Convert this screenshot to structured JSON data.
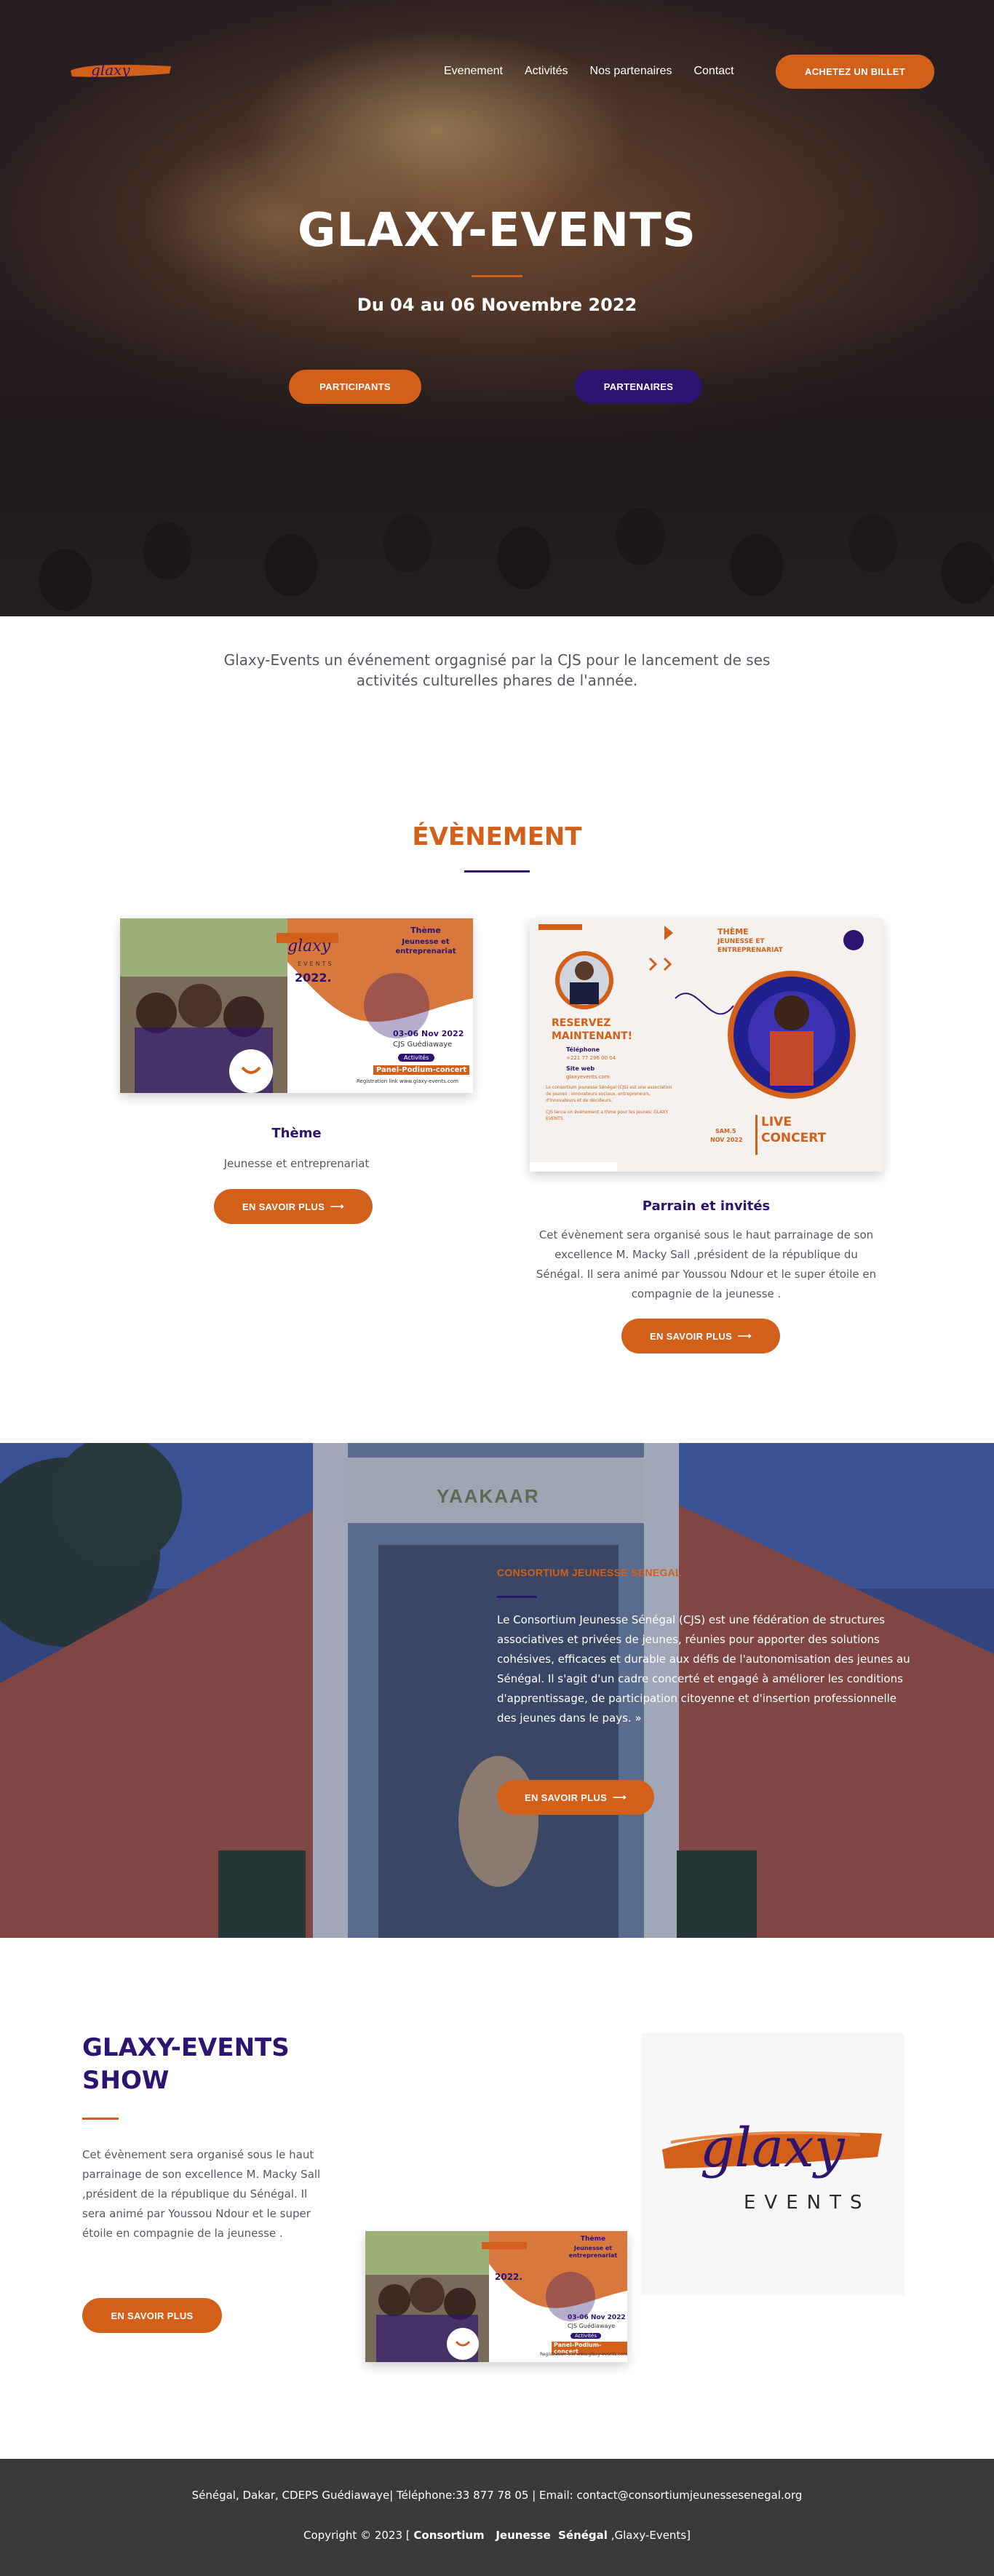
{
  "header": {
    "logo_alt": "glaxy events",
    "nav": [
      "Evenement",
      "Activités",
      "Nos partenaires",
      "Contact"
    ],
    "cta": "ACHETEZ UN BILLET"
  },
  "hero": {
    "title": "GLAXY-EVENTS",
    "subtitle": "Du 04 au 06 Novembre 2022",
    "btn_participants": "PARTICIPANTS",
    "btn_partenaires": "PARTENAIRES"
  },
  "intro": {
    "text": "Glaxy-Events un événement orgagnisé par la CJS pour le lancement de ses activités culturelles phares de l'année."
  },
  "evenement": {
    "title": "ÉVÈNEMENT",
    "cards": [
      {
        "title": "Thème",
        "text": "Jeunesse et entreprenariat",
        "button": "EN SAVOIR PLUS",
        "flyer": {
          "brand": "glaxy",
          "brand_sub": "EVENTS",
          "year": "2022.",
          "theme_label": "Thème",
          "theme_text": "Jeunesse et entreprenariat",
          "dates": "03-06 Nov 2022",
          "place": "CJS Guédiawaye",
          "activities": "Activités",
          "panel": "Panel-Podium-concert",
          "registration": "Registration link www.glaxy-events.com"
        }
      },
      {
        "title": "Parrain et invités",
        "text": "Cet évènement sera organisé sous le haut parrainage de son excellence M. Macky Sall ,président de la république du Sénégal. Il sera animé par Youssou Ndour et le super étoile en compagnie de la jeunesse .",
        "button": "EN SAVOIR PLUS",
        "flyer": {
          "theme_label": "THÈME",
          "theme_text": "JEUNESSE ET ENTREPRENARIAT",
          "reserve": "RESERVEZ MAINTENANT!",
          "phone_label": "Téléphone",
          "phone": "+221 77 296 00 04",
          "web_label": "Site web",
          "web": "glaxyevents.com",
          "blurb": "Le consortium jeunesse Sénégal (CJS) est une association de jeunes : innovateurs sociaux, entrepreneurs, d'innovateurs et de décideurs.",
          "blurb2": "CJS lance un évènement a thme pour les jeunes: GLAXY EVENTS",
          "date1": "SAM.5",
          "date2": "NOV 2022",
          "live": "LIVE",
          "concert": "CONCERT"
        }
      }
    ]
  },
  "consortium": {
    "kicker": "CONSORTIUM JEUNESSE SENEGAL",
    "text": "Le Consortium Jeunesse Sénégal (CJS) est une fédération de structures associatives et privées de jeunes, réunies pour apporter des solutions cohésives, efficaces et durable aux défis de l'autonomisation des jeunes au Sénégal. Il s'agit d'un cadre concerté et engagé à améliorer les conditions d'apprentissage, de participation citoyenne et d'insertion professionnelle des jeunes dans le pays. »",
    "button": "EN SAVOIR PLUS",
    "sign": "YAAKAAR"
  },
  "show": {
    "title": "GLAXY-EVENTS SHOW",
    "text": "Cet évènement sera organisé sous le haut parrainage de son excellence M. Macky Sall ,président de la république du Sénégal. Il sera animé par Youssou Ndour et le super étoile en compagnie de la jeunesse .",
    "button": "EN SAVOIR PLUS",
    "logo_word": "glaxy",
    "logo_sub": "EVENTS"
  },
  "footer": {
    "line1": "Sénégal, Dakar, CDEPS Guédiawaye| Téléphone:33 877 78 05 | Email: contact@consortiumjeunessesenegal.org",
    "copy_prefix": "Copyright © 2023 [ ",
    "copy_bold": "Consortium   Jeunesse  Sénégal",
    "copy_suffix": " ,Glaxy-Events]"
  },
  "colors": {
    "accent": "#d2601a",
    "brand": "#2d1470",
    "footer_bg": "#3a3a3a"
  }
}
